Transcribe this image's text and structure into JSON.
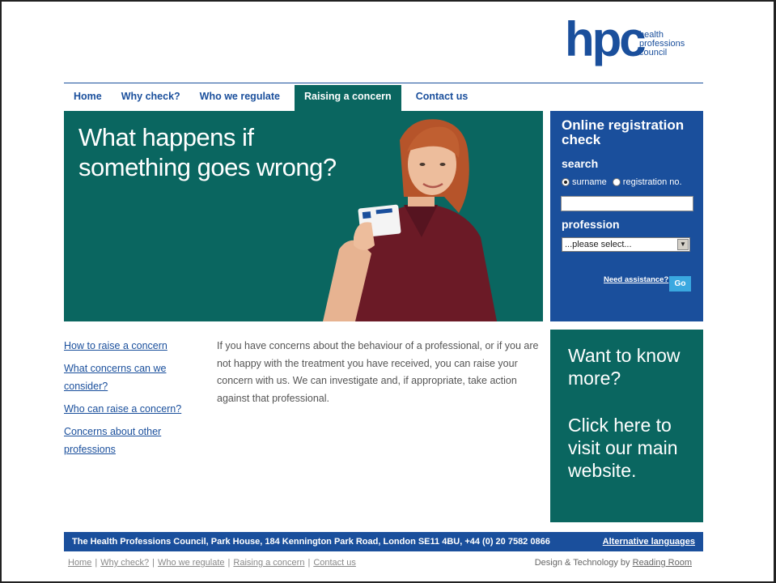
{
  "logo": {
    "mark": "hpc",
    "line1": "health",
    "line2": "professions",
    "line3": "council"
  },
  "nav": {
    "tabs": [
      {
        "label": "Home"
      },
      {
        "label": "Why check?"
      },
      {
        "label": "Who we regulate"
      },
      {
        "label": "Raising a concern",
        "active": true
      },
      {
        "label": "Contact us"
      }
    ]
  },
  "hero": {
    "line1": "What happens if",
    "line2": "something goes wrong?"
  },
  "registration": {
    "title": "Online registration check",
    "search_label": "search",
    "radio_surname": "surname",
    "radio_regno": "registration no.",
    "search_value": "",
    "profession_label": "profession",
    "profession_selected": "...please select...",
    "assist_label": "Need assistance?",
    "go_label": "Go"
  },
  "side_links": [
    "How to raise a concern",
    "What concerns can we consider?",
    "Who can raise a concern?",
    "Concerns about other professions"
  ],
  "intro": "If you have concerns about the behaviour of a professional, or if you are not happy with the treatment you have received, you can raise your concern with us. We can investigate and, if appropriate, take action against that professional.",
  "promo": {
    "line1": "Want to know more?",
    "line2": "Click here to visit our main website."
  },
  "footer": {
    "address": "The Health Professions Council, Park House, 184 Kennington Park Road, London SE11 4BU, +44 (0) 20 7582 0866",
    "alt_languages": "Alternative languages",
    "links": [
      "Home",
      "Why check?",
      "Who we regulate",
      "Raising a concern",
      "Contact us"
    ],
    "credit_prefix": "Design & Technology by",
    "credit_link": "Reading Room"
  },
  "colors": {
    "teal": "#0a6660",
    "blue": "#1a4f9c",
    "go": "#3aa8e0"
  }
}
